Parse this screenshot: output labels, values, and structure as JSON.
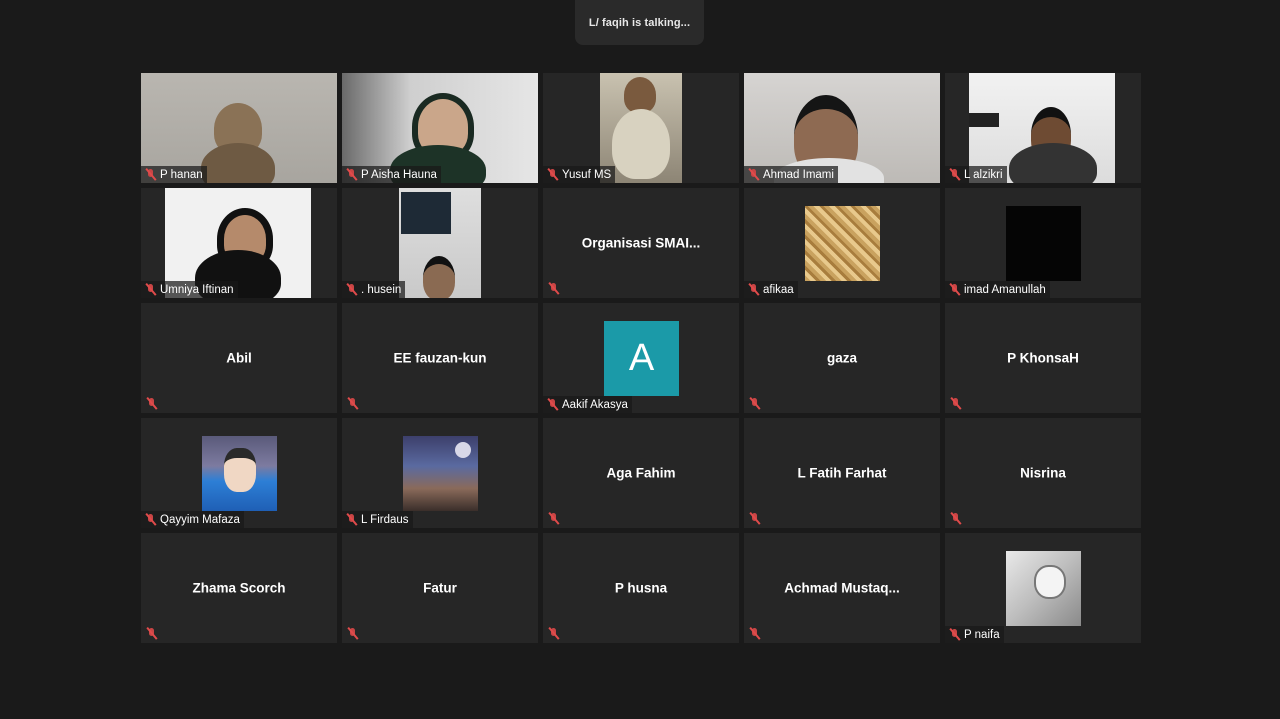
{
  "speaker": {
    "text": "L/ faqih is talking..."
  },
  "participants": [
    {
      "name": "P hanan"
    },
    {
      "name": "P Aisha Hauna"
    },
    {
      "name": "Yusuf MS"
    },
    {
      "name": "Ahmad Imami"
    },
    {
      "name": "L alzikri"
    },
    {
      "name": "Umniya Iftinan"
    },
    {
      "name": ". husein"
    },
    {
      "name": "Organisasi  SMAI..."
    },
    {
      "name": "afikaa"
    },
    {
      "name": "imad Amanullah"
    },
    {
      "name": "Abil"
    },
    {
      "name": "EE fauzan-kun"
    },
    {
      "name": "Aakif Akasya",
      "avatar_letter": "A",
      "avatar_color": "#1b9aa8"
    },
    {
      "name": "gaza"
    },
    {
      "name": "P KhonsaH"
    },
    {
      "name": "Qayyim Mafaza"
    },
    {
      "name": "L Firdaus"
    },
    {
      "name": "Aga Fahim"
    },
    {
      "name": "L Fatih Farhat"
    },
    {
      "name": "Nisrina"
    },
    {
      "name": "Zhama Scorch"
    },
    {
      "name": "Fatur"
    },
    {
      "name": "P husna"
    },
    {
      "name": "Achmad  Mustaq..."
    },
    {
      "name": "P naifa"
    }
  ],
  "colors": {
    "background": "#1a1a1a",
    "tile": "#262626",
    "muted_icon": "#e04b4b"
  },
  "icons": {
    "muted": "mic-muted-icon"
  }
}
